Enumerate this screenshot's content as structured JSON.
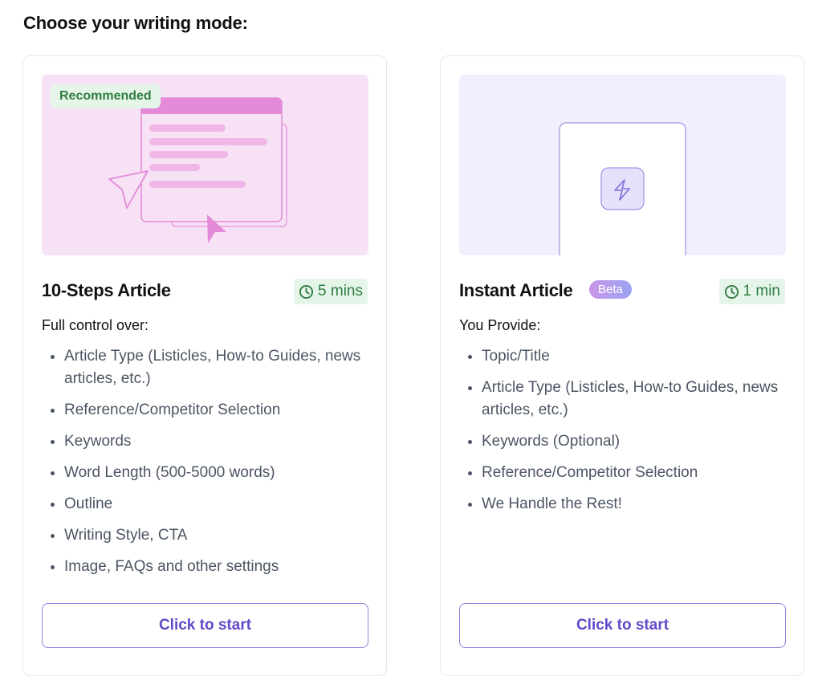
{
  "page": {
    "title": "Choose your writing mode:"
  },
  "cards": [
    {
      "badge": "Recommended",
      "title": "10-Steps Article",
      "time": "5 mins",
      "subheading": "Full control over:",
      "features": [
        "Article Type (Listicles, How-to Guides, news articles, etc.)",
        "Reference/Competitor Selection",
        "Keywords",
        "Word Length (500-5000 words)",
        "Outline",
        "Writing Style, CTA",
        "Image, FAQs and other settings"
      ],
      "button": "Click to start"
    },
    {
      "title": "Instant Article",
      "beta": "Beta",
      "time": "1 min",
      "subheading": "You Provide:",
      "features": [
        "Topic/Title",
        "Article Type (Listicles, How-to Guides, news articles, etc.)",
        "Keywords (Optional)",
        "Reference/Competitor Selection",
        "We Handle the Rest!"
      ],
      "button": "Click to start"
    }
  ],
  "colors": {
    "accent": "#6348c8",
    "success_text": "#2e7d3e",
    "success_bg": "#e6f5ea",
    "pink_bg": "#f7e2f5",
    "lavender_bg": "#f1eefe"
  },
  "icons": [
    "clock-icon",
    "cursor-arrow-icon",
    "lightning-icon",
    "document-illustration"
  ]
}
